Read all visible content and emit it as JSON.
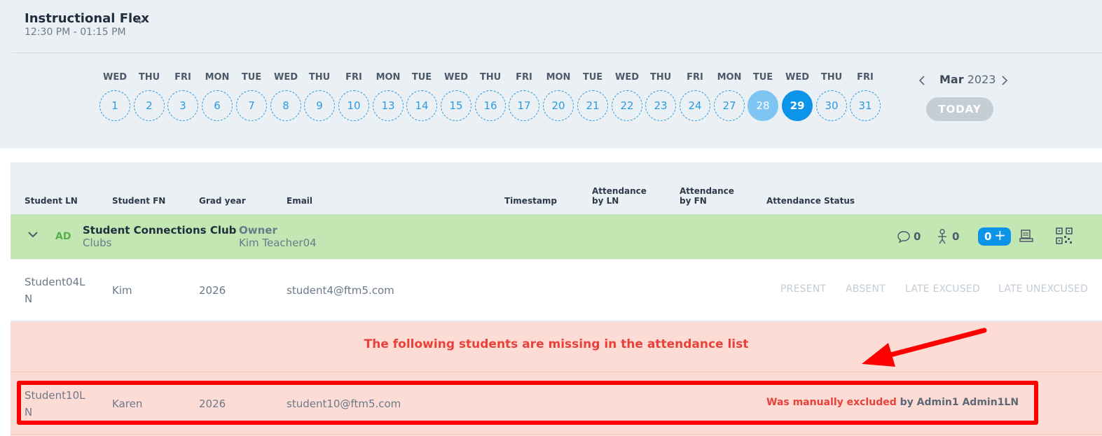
{
  "header": {
    "title": "Instructional Flex",
    "time_range": "12:30 PM - 01:15 PM"
  },
  "calendar": {
    "days": [
      {
        "dow": "WED",
        "num": "1",
        "state": "normal"
      },
      {
        "dow": "THU",
        "num": "2",
        "state": "normal"
      },
      {
        "dow": "FRI",
        "num": "3",
        "state": "normal"
      },
      {
        "dow": "MON",
        "num": "6",
        "state": "normal"
      },
      {
        "dow": "TUE",
        "num": "7",
        "state": "normal"
      },
      {
        "dow": "WED",
        "num": "8",
        "state": "normal"
      },
      {
        "dow": "THU",
        "num": "9",
        "state": "normal"
      },
      {
        "dow": "FRI",
        "num": "10",
        "state": "normal"
      },
      {
        "dow": "MON",
        "num": "13",
        "state": "normal"
      },
      {
        "dow": "TUE",
        "num": "14",
        "state": "normal"
      },
      {
        "dow": "WED",
        "num": "15",
        "state": "normal"
      },
      {
        "dow": "THU",
        "num": "16",
        "state": "normal"
      },
      {
        "dow": "FRI",
        "num": "17",
        "state": "normal"
      },
      {
        "dow": "MON",
        "num": "20",
        "state": "normal"
      },
      {
        "dow": "TUE",
        "num": "21",
        "state": "normal"
      },
      {
        "dow": "WED",
        "num": "22",
        "state": "normal"
      },
      {
        "dow": "THU",
        "num": "23",
        "state": "normal"
      },
      {
        "dow": "FRI",
        "num": "24",
        "state": "normal"
      },
      {
        "dow": "MON",
        "num": "27",
        "state": "normal"
      },
      {
        "dow": "TUE",
        "num": "28",
        "state": "past"
      },
      {
        "dow": "WED",
        "num": "29",
        "state": "selected"
      },
      {
        "dow": "THU",
        "num": "30",
        "state": "normal"
      },
      {
        "dow": "FRI",
        "num": "31",
        "state": "normal"
      }
    ],
    "month": "Mar",
    "year": "2023",
    "today_label": "TODAY"
  },
  "table": {
    "headers": {
      "student_ln": "Student LN",
      "student_fn": "Student FN",
      "grad_year": "Grad year",
      "email": "Email",
      "timestamp": "Timestamp",
      "att_by_ln_1": "Attendance",
      "att_by_ln_2": "by LN",
      "att_by_fn_1": "Attendance",
      "att_by_fn_2": "by FN",
      "att_status": "Attendance Status"
    }
  },
  "club": {
    "abbr": "AD",
    "name": "Student Connections Club",
    "category": "Clubs",
    "owner_label": "Owner",
    "owner_name": "Kim Teacher04",
    "comments_count": "0",
    "members_count": "0",
    "add_count": "0",
    "add_symbol": "+"
  },
  "student": {
    "ln_line1": "Student04L",
    "ln_line2": "N",
    "fn": "Kim",
    "grad_year": "2026",
    "email": "student4@ftm5.com",
    "buttons": {
      "present": "PRESENT",
      "absent": "ABSENT",
      "late_excused": "LATE EXCUSED",
      "late_unexcused": "LATE UNEXCUSED"
    }
  },
  "missing": {
    "banner": "The following students are missing in the attendance list",
    "student": {
      "ln_line1": "Student10L",
      "ln_line2": "N",
      "fn": "Karen",
      "grad_year": "2026",
      "email": "student10@ftm5.com",
      "note_status": "Was manually excluded",
      "note_by": "by Admin1 Admin1LN"
    }
  },
  "colors": {
    "selected_day": "#0b94e8",
    "past_day": "#7fc5f3",
    "club_row": "#c3e7b3",
    "missing_bg": "#fcdcd5",
    "alert_red": "#e8413a",
    "annotation_red": "#ff0000"
  },
  "icons": {
    "period_dropdown": "chevron-down-icon",
    "month_prev": "chevron-left-icon",
    "month_next": "chevron-right-icon",
    "club_toggle": "chevron-down-icon",
    "comments": "comment-icon",
    "members": "person-icon",
    "kiosk": "kiosk-icon",
    "qr": "qr-code-icon"
  }
}
